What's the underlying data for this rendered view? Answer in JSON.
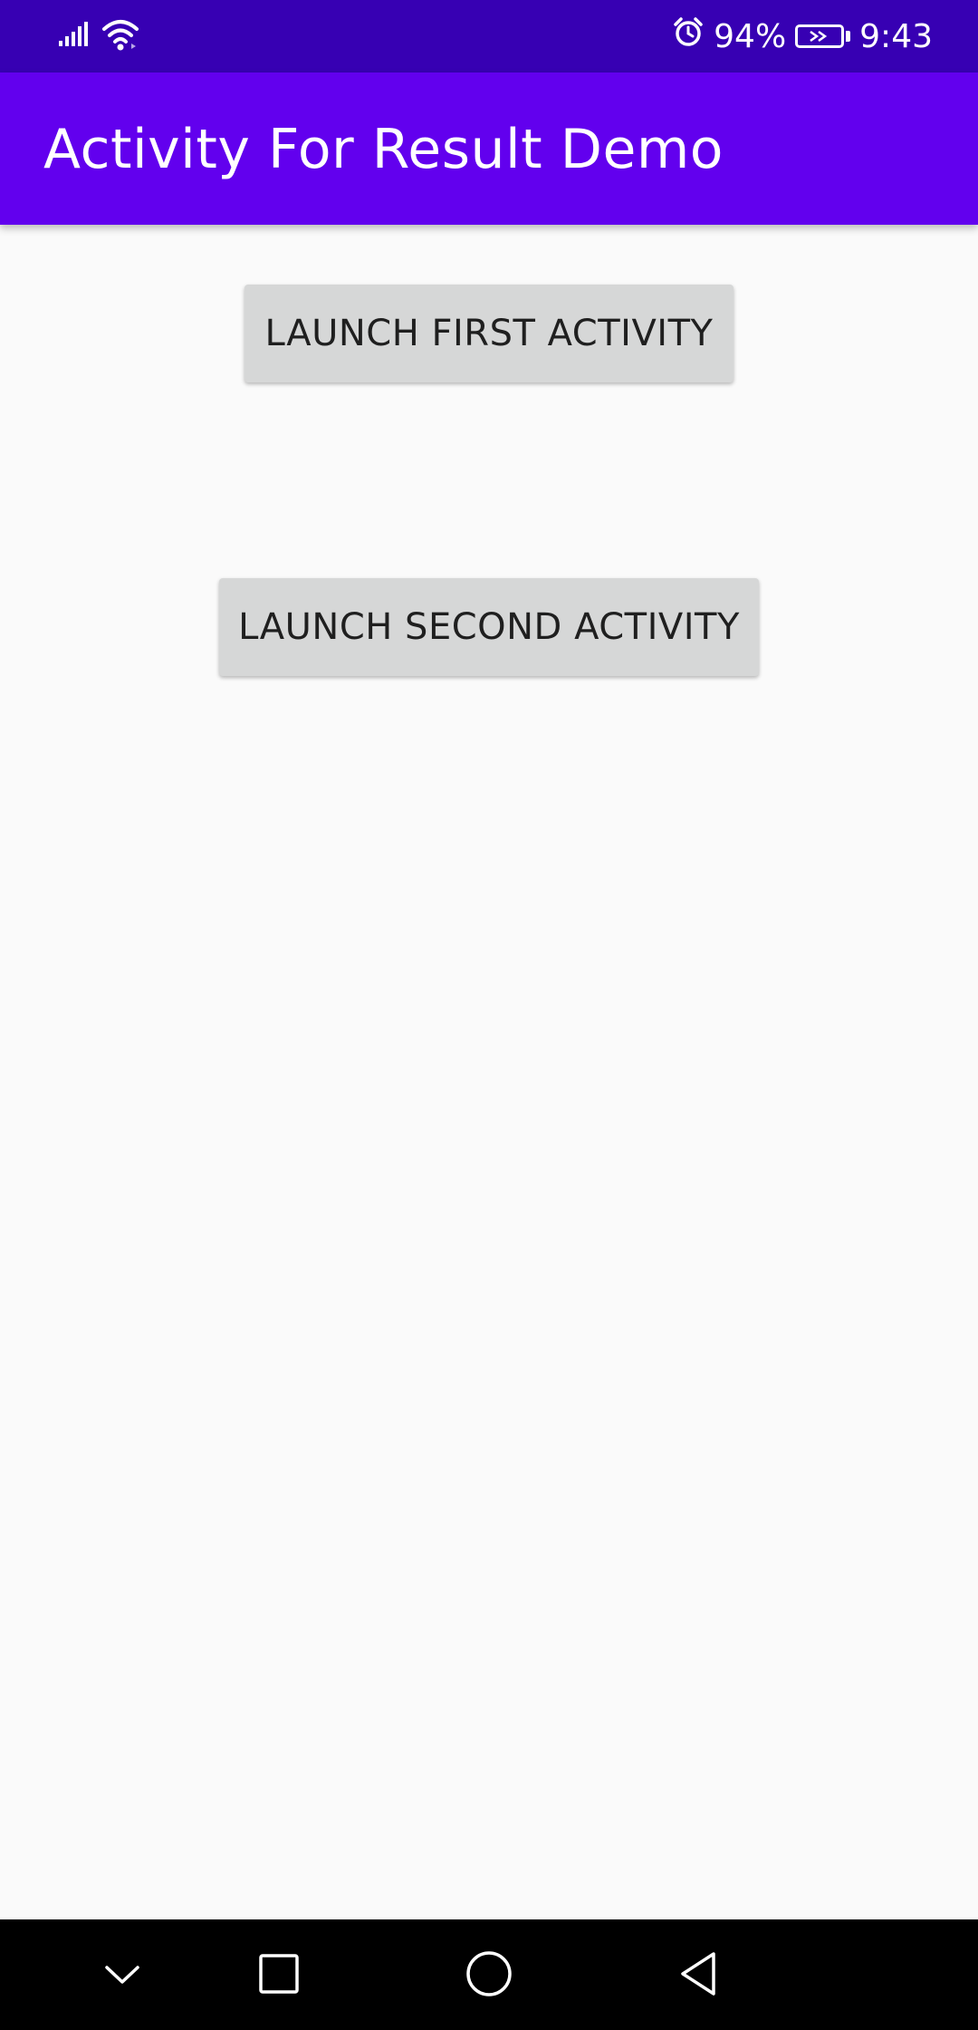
{
  "status_bar": {
    "icons": [
      "signal-icon",
      "wifi-icon",
      "alarm-icon",
      "battery-icon"
    ],
    "battery": "94%",
    "time": "9:43"
  },
  "app_bar": {
    "title": "Activity For Result Demo",
    "color": "#6200EE",
    "status_color": "#3700B3"
  },
  "main": {
    "button_first": "LAUNCH FIRST ACTIVITY",
    "button_second": "LAUNCH SECOND ACTIVITY"
  },
  "nav_bar": {
    "icons": [
      "chevron-down-icon",
      "recents-square-icon",
      "home-circle-icon",
      "back-triangle-icon"
    ]
  }
}
